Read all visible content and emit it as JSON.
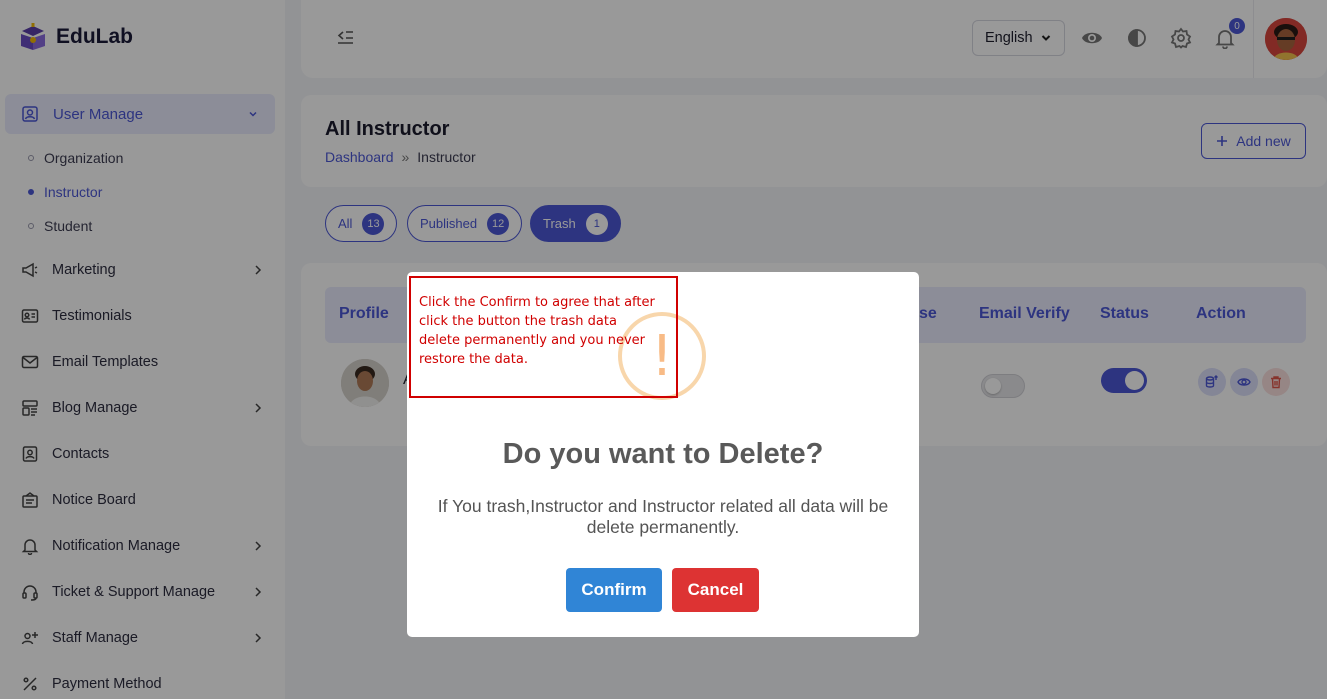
{
  "brand": {
    "name": "EduLab"
  },
  "sidebar": {
    "active_group": "User Manage",
    "sub_items": [
      {
        "label": "Organization",
        "active": false
      },
      {
        "label": "Instructor",
        "active": true
      },
      {
        "label": "Student",
        "active": false
      }
    ],
    "items": [
      {
        "label": "Marketing",
        "icon": "megaphone-icon",
        "has_children": true
      },
      {
        "label": "Testimonials",
        "icon": "id-card-icon",
        "has_children": false
      },
      {
        "label": "Email Templates",
        "icon": "mail-icon",
        "has_children": false
      },
      {
        "label": "Blog Manage",
        "icon": "blog-icon",
        "has_children": true
      },
      {
        "label": "Contacts",
        "icon": "contacts-icon",
        "has_children": false
      },
      {
        "label": "Notice Board",
        "icon": "notice-board-icon",
        "has_children": false
      },
      {
        "label": "Notification Manage",
        "icon": "bell-icon",
        "has_children": true
      },
      {
        "label": "Ticket & Support Manage",
        "icon": "headset-icon",
        "has_children": true
      },
      {
        "label": "Staff Manage",
        "icon": "users-plus-icon",
        "has_children": true
      },
      {
        "label": "Payment Method",
        "icon": "percent-icon",
        "has_children": false
      }
    ]
  },
  "topbar": {
    "language": "English",
    "notification_count": "0"
  },
  "page": {
    "title": "All Instructor",
    "breadcrumb_home": "Dashboard",
    "breadcrumb_sep": "»",
    "breadcrumb_current": "Instructor",
    "add_new_label": "Add new"
  },
  "filters": [
    {
      "label": "All",
      "count": "13",
      "active": false
    },
    {
      "label": "Published",
      "count": "12",
      "active": false
    },
    {
      "label": "Trash",
      "count": "1",
      "active": true
    }
  ],
  "table": {
    "headers": {
      "profile": "Profile",
      "course": "urse",
      "email_verify": "Email Verify",
      "status": "Status",
      "action": "Action"
    },
    "row_name_fragment": "A"
  },
  "modal": {
    "title": "Do you want to Delete?",
    "text": "If You trash,Instructor and Instructor related all data will be delete permanently.",
    "confirm_label": "Confirm",
    "cancel_label": "Cancel",
    "warning_glyph": "!"
  },
  "annotation": {
    "text": "Click the Confirm to agree that after click the button the trash data delete permanently and you never restore the data."
  },
  "colors": {
    "accent": "#4c58d6",
    "confirm": "#3085d6",
    "cancel": "#dd3333",
    "annotation": "#d00000"
  }
}
